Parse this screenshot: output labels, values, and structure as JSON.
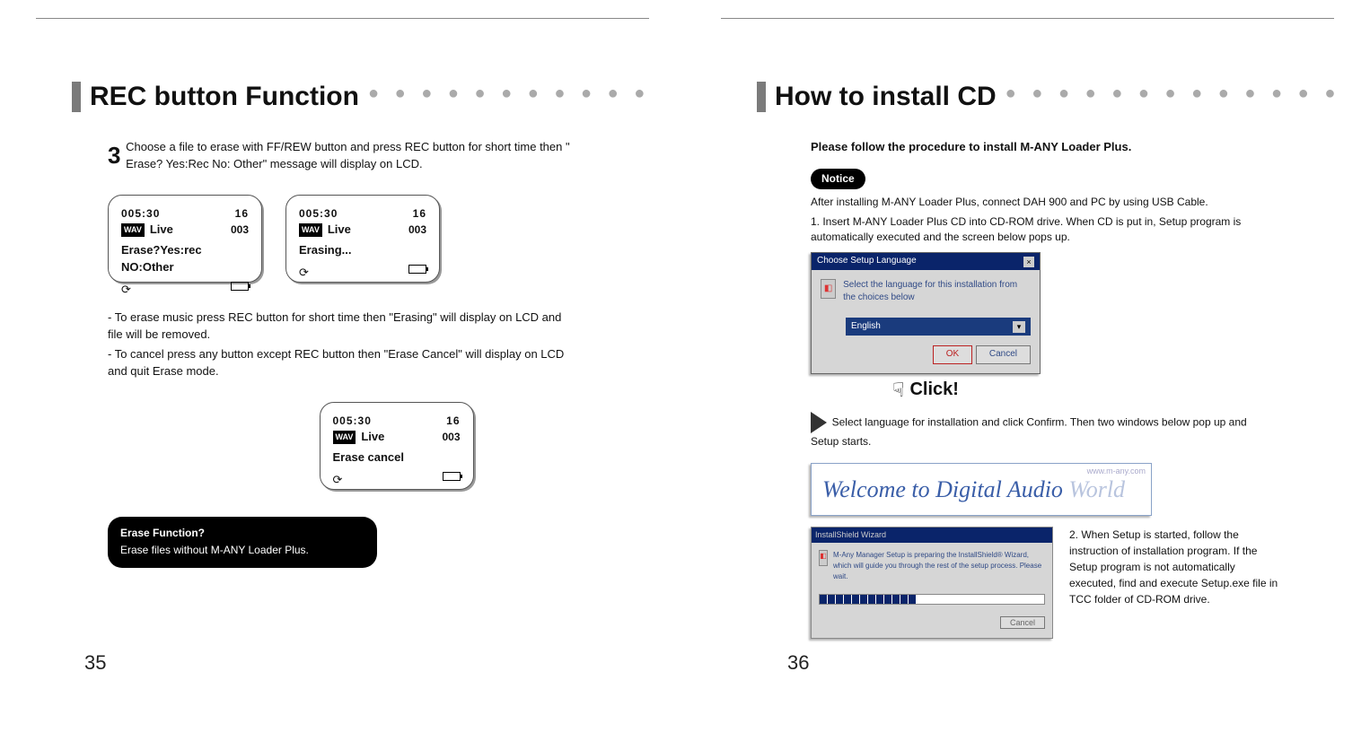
{
  "left": {
    "heading": "REC button Function",
    "step_num": "3",
    "step_text": "Choose a file to erase with FF/REW button and press REC button for short time then \" Erase? Yes:Rec No: Other\" message will display on LCD.",
    "lcd1": {
      "time": "005:30",
      "track": "16",
      "format": "WAV",
      "title": "Live",
      "count": "003",
      "msg": "Erase?Yes:rec NO:Other"
    },
    "lcd2": {
      "time": "005:30",
      "track": "16",
      "format": "WAV",
      "title": "Live",
      "count": "003",
      "msg": "Erasing..."
    },
    "lcd3": {
      "time": "005:30",
      "track": "16",
      "format": "WAV",
      "title": "Live",
      "count": "003",
      "msg": "Erase cancel"
    },
    "note1": "- To erase music press REC button for short time then \"Erasing\" will display on LCD and file will be removed.",
    "note2": "- To cancel press any button except REC button then \"Erase Cancel\" will display on LCD and quit Erase mode.",
    "tip_title": "Erase Function?",
    "tip_body": "Erase files without M-ANY Loader Plus.",
    "page_num": "35"
  },
  "right": {
    "heading": "How to install CD",
    "intro": "Please follow the procedure to install M-ANY Loader Plus.",
    "notice_label": "Notice",
    "notice_text": "After installing M-ANY Loader Plus, connect DAH 900 and PC by using USB Cable.",
    "step1": "1. Insert M-ANY Loader Plus CD into CD-ROM drive. When CD is put in, Setup program is automatically executed and the screen below pops up.",
    "dialog1": {
      "title": "Choose Setup Language",
      "body": "Select the language for this installation from the choices below",
      "option": "English",
      "ok": "OK",
      "cancel": "Cancel"
    },
    "click": "Click!",
    "after_click": "Select language for installation and click Confirm. Then two windows below pop up and Setup starts.",
    "banner": {
      "url": "www.m-any.com",
      "text_pre": "Welcome  to  ",
      "text_em1": "Digital ",
      "text_em2": "Audio ",
      "text_em3": "World"
    },
    "wizard": {
      "title": "InstallShield Wizard",
      "body": "M-Any Manager Setup is preparing the InstallShield® Wizard, which will guide you through the rest of the setup process. Please wait.",
      "cancel": "Cancel"
    },
    "step2": "2. When Setup is started, follow the instruction of installation program. If the Setup program is not automatically executed, find and execute Setup.exe file in TCC folder of CD-ROM drive.",
    "page_num": "36"
  }
}
